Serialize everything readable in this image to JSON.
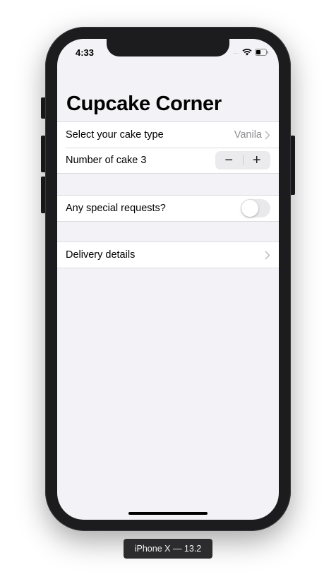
{
  "status_bar": {
    "time": "4:33",
    "signal": "....",
    "icons": [
      "wifi-icon",
      "battery-icon"
    ]
  },
  "nav": {
    "title": "Cupcake Corner"
  },
  "section_cake": {
    "type_label": "Select your cake type",
    "type_value": "Vanila",
    "quantity_label": "Number of cake 3",
    "stepper_minus": "−",
    "stepper_plus": "+"
  },
  "section_requests": {
    "label": "Any special requests?",
    "toggle_on": false
  },
  "section_delivery": {
    "label": "Delivery details"
  },
  "device": {
    "label": "iPhone X — 13.2"
  },
  "colors": {
    "background": "#f2f2f7",
    "cell": "#ffffff",
    "secondary_text": "#8e8e93",
    "chevron": "#c4c4c7",
    "device_frame": "#1c1c1e"
  }
}
